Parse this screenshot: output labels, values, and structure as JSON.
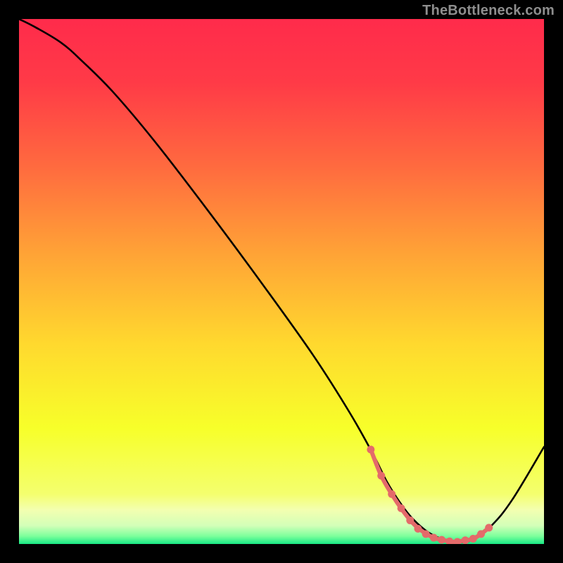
{
  "attribution": "TheBottleneck.com",
  "chart_data": {
    "type": "line",
    "title": "",
    "xlabel": "",
    "ylabel": "",
    "xlim": [
      0,
      100
    ],
    "ylim": [
      0,
      100
    ],
    "gradient_stops": [
      {
        "offset": 0.0,
        "color": "#ff2b4b"
      },
      {
        "offset": 0.12,
        "color": "#ff3a47"
      },
      {
        "offset": 0.28,
        "color": "#ff6a3f"
      },
      {
        "offset": 0.45,
        "color": "#ffa436"
      },
      {
        "offset": 0.62,
        "color": "#ffd92e"
      },
      {
        "offset": 0.78,
        "color": "#f7ff2a"
      },
      {
        "offset": 0.905,
        "color": "#f4ff6e"
      },
      {
        "offset": 0.935,
        "color": "#f3ffb0"
      },
      {
        "offset": 0.965,
        "color": "#d3ffb8"
      },
      {
        "offset": 0.985,
        "color": "#7dff9c"
      },
      {
        "offset": 1.0,
        "color": "#17e884"
      }
    ],
    "series": [
      {
        "name": "bottleneck-curve",
        "stroke": "#000000",
        "x": [
          0.0,
          3.0,
          8.0,
          12.0,
          18.0,
          26.0,
          36.0,
          46.0,
          56.0,
          63.0,
          67.5,
          70.0,
          72.5,
          75.0,
          78.0,
          81.0,
          83.8,
          86.5,
          90.0,
          94.0,
          100.0
        ],
        "values": [
          100.0,
          98.5,
          95.5,
          92.0,
          86.0,
          76.5,
          63.5,
          50.0,
          36.0,
          25.0,
          17.0,
          12.0,
          8.0,
          4.8,
          2.2,
          0.8,
          0.3,
          0.9,
          3.5,
          8.5,
          18.5
        ]
      },
      {
        "name": "highlight-band",
        "stroke": "#e46a6a",
        "x": [
          67.0,
          69.0,
          71.0,
          73.0,
          75.0,
          77.0,
          79.0,
          81.0,
          83.0,
          85.0,
          86.5,
          88.0,
          89.5
        ],
        "values": [
          18.0,
          13.0,
          9.5,
          6.5,
          4.0,
          2.3,
          1.2,
          0.7,
          0.4,
          0.7,
          1.0,
          1.9,
          3.1
        ]
      }
    ],
    "highlight_dots": {
      "color": "#e46a6a",
      "points": [
        {
          "x": 67.0,
          "y": 18.0
        },
        {
          "x": 69.0,
          "y": 13.0
        },
        {
          "x": 71.0,
          "y": 9.5
        },
        {
          "x": 72.8,
          "y": 6.8
        },
        {
          "x": 74.5,
          "y": 4.5
        },
        {
          "x": 76.0,
          "y": 2.9
        },
        {
          "x": 77.5,
          "y": 1.9
        },
        {
          "x": 79.0,
          "y": 1.2
        },
        {
          "x": 80.5,
          "y": 0.8
        },
        {
          "x": 82.0,
          "y": 0.5
        },
        {
          "x": 83.5,
          "y": 0.4
        },
        {
          "x": 85.0,
          "y": 0.7
        },
        {
          "x": 86.5,
          "y": 1.0
        },
        {
          "x": 88.0,
          "y": 1.9
        },
        {
          "x": 89.5,
          "y": 3.1
        }
      ]
    }
  }
}
